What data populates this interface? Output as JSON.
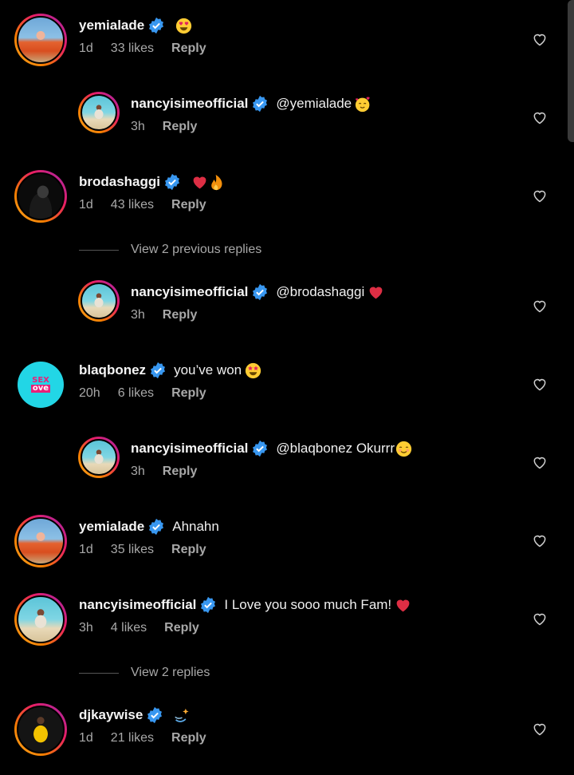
{
  "comments": [
    {
      "username": "yemialade",
      "text": "",
      "emoji": "heart-eyes",
      "time": "1d",
      "likes": "33 likes",
      "reply": "Reply"
    },
    {
      "username": "nancyisimeofficial",
      "text": "@yemialade",
      "emoji": "smiling-hearts",
      "time": "3h",
      "likes": "",
      "reply": "Reply"
    },
    {
      "username": "brodashaggi",
      "text": "",
      "emoji": "heart-fire",
      "time": "1d",
      "likes": "43 likes",
      "reply": "Reply"
    },
    {
      "username": "nancyisimeofficial",
      "text": "@brodashaggi",
      "emoji": "red-heart",
      "time": "3h",
      "likes": "",
      "reply": "Reply"
    },
    {
      "username": "blaqbonez",
      "text": "you’ve won",
      "emoji": "star-struck",
      "time": "20h",
      "likes": "6 likes",
      "reply": "Reply"
    },
    {
      "username": "nancyisimeofficial",
      "text": "@blaqbonez Okurrr",
      "emoji": "smiling-blush",
      "time": "3h",
      "likes": "",
      "reply": "Reply"
    },
    {
      "username": "yemialade",
      "text": "Ahnahn",
      "emoji": "",
      "time": "1d",
      "likes": "35 likes",
      "reply": "Reply"
    },
    {
      "username": "nancyisimeofficial",
      "text": "I Love you sooo much Fam!",
      "emoji": "red-heart",
      "time": "3h",
      "likes": "4 likes",
      "reply": "Reply"
    },
    {
      "username": "djkaywise",
      "text": "",
      "emoji": "dizzy",
      "time": "1d",
      "likes": "21 likes",
      "reply": "Reply"
    }
  ],
  "view_replies": [
    {
      "label": "View 2 previous replies"
    },
    {
      "label": "View 2 replies"
    }
  ],
  "avatar_badge": {
    "line1": "SEX",
    "line2": "ove"
  },
  "colors": {
    "background": "#000000",
    "verified": "#3897f0",
    "secondary_text": "#a8a8a8",
    "story_ring_start": "#f9a825",
    "story_ring_end": "#9c27b0"
  }
}
